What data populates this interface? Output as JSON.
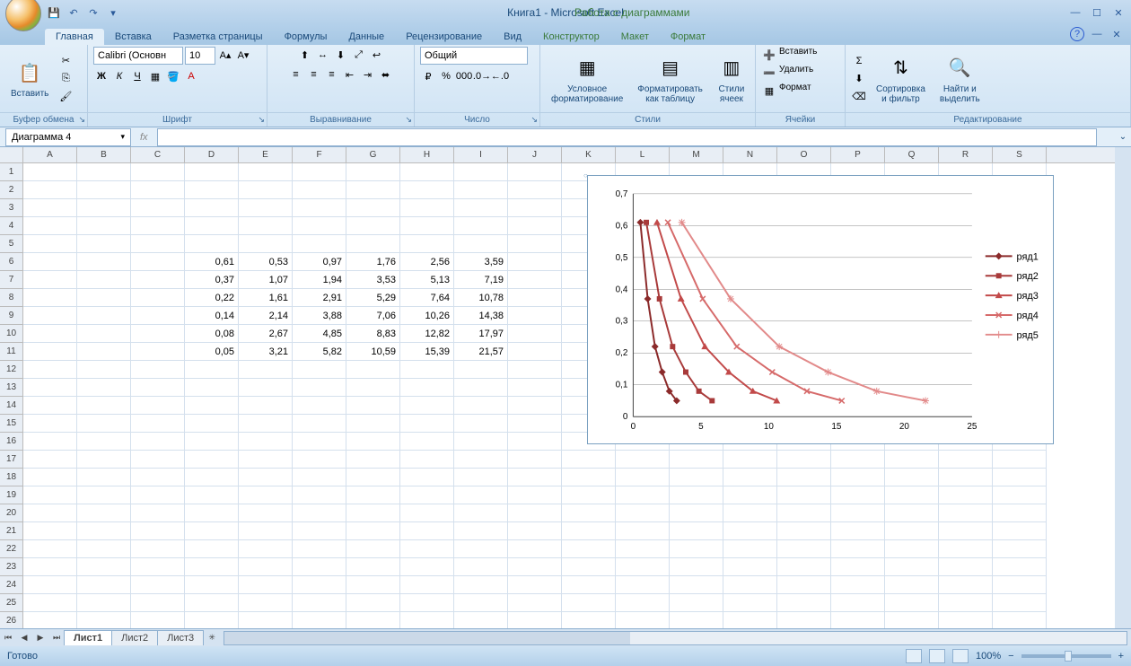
{
  "titlebar": {
    "title": "Книга1 - Microsoft Excel",
    "chart_tools": "Работа с диаграммами"
  },
  "tabs": {
    "home": "Главная",
    "insert": "Вставка",
    "layout": "Разметка страницы",
    "formulas": "Формулы",
    "data": "Данные",
    "review": "Рецензирование",
    "view": "Вид",
    "chart_design": "Конструктор",
    "chart_layout": "Макет",
    "chart_format": "Формат"
  },
  "ribbon": {
    "clipboard": {
      "label": "Буфер обмена",
      "paste": "Вставить"
    },
    "font": {
      "label": "Шрифт",
      "name": "Calibri (Основн",
      "size": "10"
    },
    "align": {
      "label": "Выравнивание"
    },
    "number": {
      "label": "Число",
      "format": "Общий"
    },
    "styles": {
      "label": "Стили",
      "cond": "Условное\nформатирование",
      "table": "Форматировать\nкак таблицу",
      "cell": "Стили\nячеек"
    },
    "cells": {
      "label": "Ячейки",
      "insert": "Вставить",
      "delete": "Удалить",
      "format": "Формат"
    },
    "editing": {
      "label": "Редактирование",
      "sort": "Сортировка\nи фильтр",
      "find": "Найти и\nвыделить"
    }
  },
  "formulabar": {
    "name": "Диаграмма 4",
    "fx": "fx"
  },
  "columns": [
    "A",
    "B",
    "C",
    "D",
    "E",
    "F",
    "G",
    "H",
    "I",
    "J",
    "K",
    "L",
    "M",
    "N",
    "O",
    "P",
    "Q",
    "R",
    "S"
  ],
  "rows": [
    1,
    2,
    3,
    4,
    5,
    6,
    7,
    8,
    9,
    10,
    11,
    12,
    13,
    14,
    15,
    16,
    17,
    18,
    19,
    20,
    21,
    22,
    23,
    24,
    25,
    26
  ],
  "table_data": {
    "start_row": 6,
    "start_col": 3,
    "rows": [
      [
        "0,61",
        "0,53",
        "0,97",
        "1,76",
        "2,56",
        "3,59"
      ],
      [
        "0,37",
        "1,07",
        "1,94",
        "3,53",
        "5,13",
        "7,19"
      ],
      [
        "0,22",
        "1,61",
        "2,91",
        "5,29",
        "7,64",
        "10,78"
      ],
      [
        "0,14",
        "2,14",
        "3,88",
        "7,06",
        "10,26",
        "14,38"
      ],
      [
        "0,08",
        "2,67",
        "4,85",
        "8,83",
        "12,82",
        "17,97"
      ],
      [
        "0,05",
        "3,21",
        "5,82",
        "10,59",
        "15,39",
        "21,57"
      ]
    ]
  },
  "chart_data": {
    "type": "line",
    "xlim": [
      0,
      25
    ],
    "ylim": [
      0,
      0.7
    ],
    "xticks": [
      0,
      5,
      10,
      15,
      20,
      25
    ],
    "yticks": [
      0,
      0.1,
      0.2,
      0.3,
      0.4,
      0.5,
      0.6,
      0.7
    ],
    "legend": [
      "ряд1",
      "ряд2",
      "ряд3",
      "ряд4",
      "ряд5"
    ],
    "series": [
      {
        "name": "ряд1",
        "color": "#8b2a2a",
        "marker": "diamond",
        "x": [
          0.53,
          1.07,
          1.61,
          2.14,
          2.67,
          3.21
        ],
        "y": [
          0.61,
          0.37,
          0.22,
          0.14,
          0.08,
          0.05
        ]
      },
      {
        "name": "ряд2",
        "color": "#a83a3a",
        "marker": "square",
        "x": [
          0.97,
          1.94,
          2.91,
          3.88,
          4.85,
          5.82
        ],
        "y": [
          0.61,
          0.37,
          0.22,
          0.14,
          0.08,
          0.05
        ]
      },
      {
        "name": "ряд3",
        "color": "#c24a4a",
        "marker": "triangle",
        "x": [
          1.76,
          3.53,
          5.29,
          7.06,
          8.83,
          10.59
        ],
        "y": [
          0.61,
          0.37,
          0.22,
          0.14,
          0.08,
          0.05
        ]
      },
      {
        "name": "ряд4",
        "color": "#d66a6a",
        "marker": "x",
        "x": [
          2.56,
          5.13,
          7.64,
          10.26,
          12.82,
          15.39
        ],
        "y": [
          0.61,
          0.37,
          0.22,
          0.14,
          0.08,
          0.05
        ]
      },
      {
        "name": "ряд5",
        "color": "#e28a8a",
        "marker": "star",
        "x": [
          3.59,
          7.19,
          10.78,
          14.38,
          17.97,
          21.57
        ],
        "y": [
          0.61,
          0.37,
          0.22,
          0.14,
          0.08,
          0.05
        ]
      }
    ]
  },
  "sheets": {
    "s1": "Лист1",
    "s2": "Лист2",
    "s3": "Лист3"
  },
  "statusbar": {
    "ready": "Готово",
    "zoom": "100%"
  }
}
